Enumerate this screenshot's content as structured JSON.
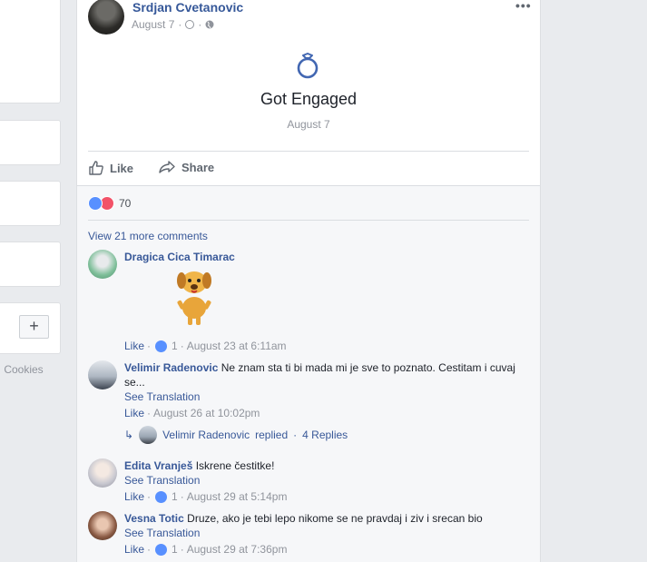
{
  "left_sidebar": {
    "add_button_label": "+",
    "footer_text": "· Cookies"
  },
  "post": {
    "author": "Srdjan Cvetanovic",
    "date": "August 7",
    "meta_separators": "·",
    "more_icon": "more-options-icon",
    "life_event": {
      "icon": "ring-icon",
      "title": "Got Engaged",
      "date": "August 7"
    },
    "actions": {
      "like": "Like",
      "share": "Share"
    },
    "reactions": {
      "types": [
        "like",
        "love"
      ],
      "count": "70"
    },
    "view_more_comments": "View 21 more comments",
    "comments": [
      {
        "name": "Dragica Cica Timarac",
        "text": "",
        "sticker": "dog-sticker",
        "like_label": "Like",
        "like_count": "1",
        "time": "August 23 at 6:11am",
        "avatar_color": "#7fbf9a"
      },
      {
        "name": "Velimir Radenovic",
        "text": "Ne znam sta ti bi mada mi je sve to poznato. Cestitam i cuvaj se...",
        "translate": "See Translation",
        "like_label": "Like",
        "time": "August 26 at 10:02pm",
        "reply_summary": {
          "author": "Velimir Radenovic",
          "action": "replied",
          "count": "4 Replies"
        },
        "avatar_color": "#aeb7c2"
      },
      {
        "name": "Edita Vranješ",
        "text": "Iskrene čestitke!",
        "translate": "See Translation",
        "like_label": "Like",
        "like_count": "1",
        "time": "August 29 at 5:14pm",
        "avatar_color": "#c8c8d0"
      },
      {
        "name": "Vesna Totic",
        "text": "Druze, ako je tebi lepo nikome se ne pravdaj i ziv i srecan bio",
        "translate": "See Translation",
        "like_label": "Like",
        "like_count": "1",
        "time": "August 29 at 7:36pm",
        "avatar_color": "#8a5a44"
      }
    ]
  },
  "colors": {
    "link_blue": "#385898",
    "author_blue": "#365899",
    "muted_gray": "#90949c",
    "ring_blue": "#4267b2",
    "like_blue": "#5890ff",
    "love_red": "#f25268"
  }
}
